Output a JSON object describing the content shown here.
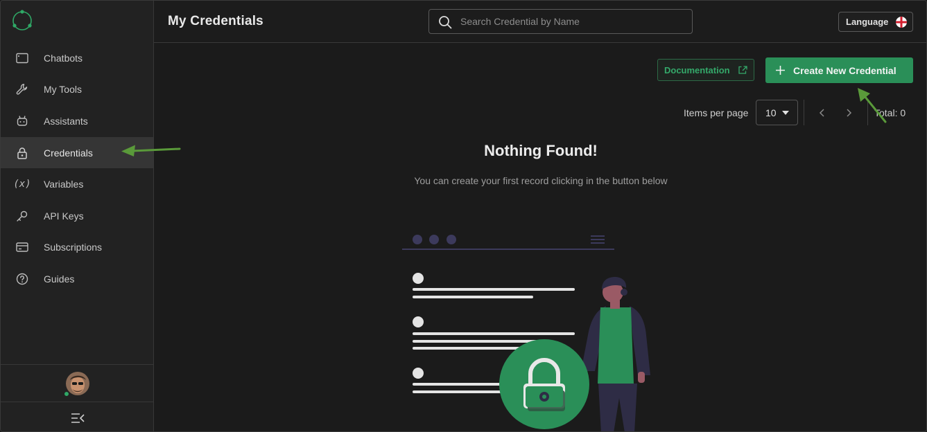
{
  "app": {
    "logo_icon": "app-logo-icon"
  },
  "sidebar": {
    "items": [
      {
        "label": "Chatbots",
        "icon": "chat-window-icon",
        "active": false
      },
      {
        "label": "My Tools",
        "icon": "wrench-icon",
        "active": false
      },
      {
        "label": "Assistants",
        "icon": "robot-icon",
        "active": false
      },
      {
        "label": "Credentials",
        "icon": "lock-icon",
        "active": true
      },
      {
        "label": "Variables",
        "icon": "variable-icon",
        "active": false
      },
      {
        "label": "API Keys",
        "icon": "key-icon",
        "active": false
      },
      {
        "label": "Subscriptions",
        "icon": "credit-card-icon",
        "active": false
      },
      {
        "label": "Guides",
        "icon": "question-circle-icon",
        "active": false
      }
    ],
    "variable_glyph": "(x)"
  },
  "header": {
    "title": "My Credentials",
    "search_placeholder": "Search Credential by Name",
    "language_label": "Language"
  },
  "actions": {
    "documentation_label": "Documentation",
    "create_label": "Create New Credential"
  },
  "pagination": {
    "items_per_page_label": "Items per page",
    "items_per_page_value": "10",
    "total_label": "Total: 0"
  },
  "empty_state": {
    "title": "Nothing Found!",
    "subtitle": "You can create your first record clicking in the button below"
  },
  "colors": {
    "accent": "#2a8f58",
    "accent_text": "#34a96a",
    "annotation_arrow": "#5a9a3a",
    "background": "#1b1b1b",
    "sidebar": "#222222"
  }
}
